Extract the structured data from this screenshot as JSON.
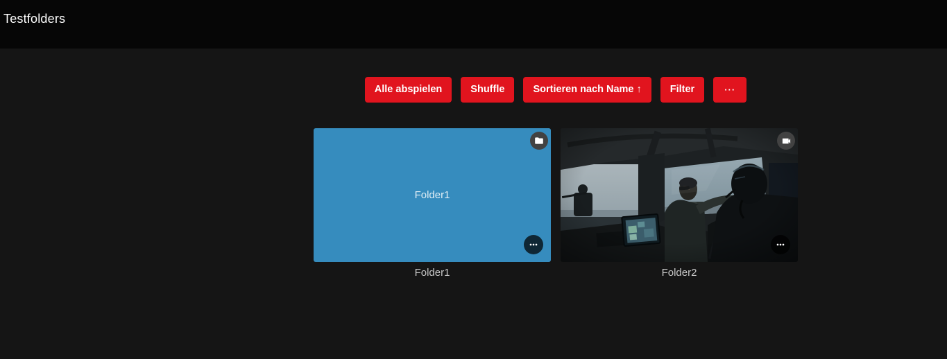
{
  "header": {
    "title": "Testfolders"
  },
  "toolbar": {
    "play_all_label": "Alle abspielen",
    "shuffle_label": "Shuffle",
    "sort_label": "Sortieren nach Name",
    "sort_direction_icon": "↑",
    "filter_label": "Filter",
    "more_label": "···"
  },
  "library": {
    "cards": [
      {
        "title": "Folder1",
        "center_label": "Folder1",
        "type_icon": "folder-icon"
      },
      {
        "title": "Folder2",
        "type_icon": "videocam-icon"
      }
    ]
  },
  "colors": {
    "accent_red": "#e1141e",
    "folder_card_blue": "#368cbe",
    "header_bg": "#060606",
    "page_bg": "#151515"
  }
}
